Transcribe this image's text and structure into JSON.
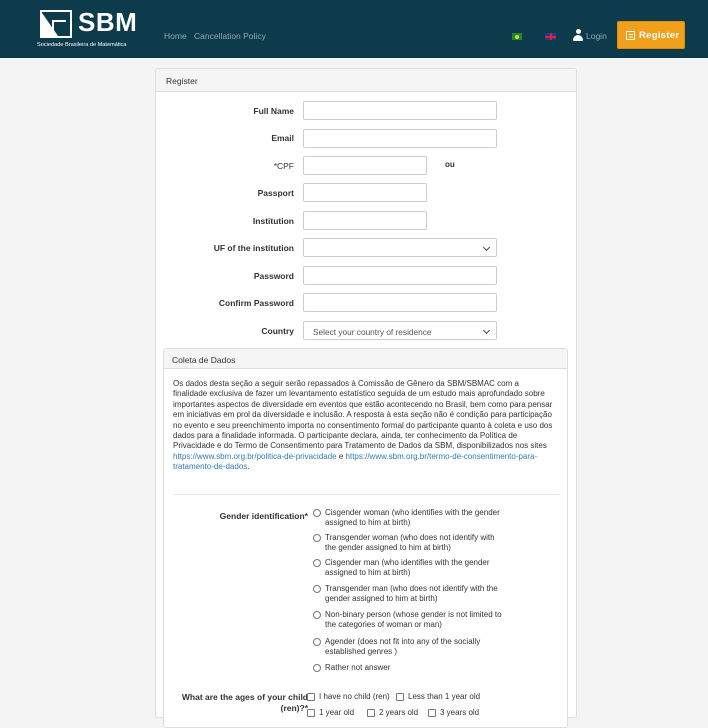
{
  "header": {
    "logo_text": "SBM",
    "logo_subtitle": "Sociedade Brasileira de Matemática",
    "nav": [
      "Home",
      "Cancellation Policy"
    ],
    "login_label": "Login",
    "register_label": "Register",
    "colors": {
      "navbar": "#0d3b4c",
      "accent": "#f0a01a"
    }
  },
  "form": {
    "title": "Register",
    "fields": {
      "full_name": "Full Name",
      "email": "Email",
      "cpf": "*CPF",
      "cpf_or": "ou",
      "passport": "Passport",
      "institution": "Institution",
      "uf": "UF of the institution",
      "password": "Password",
      "confirm_password": "Confirm Password",
      "country": "Country",
      "country_placeholder": "Select your country of residence"
    }
  },
  "data_collection": {
    "title": "Coleta de Dados",
    "paragraph": "Os dados desta seção a seguir serão repassados à Comissão de Gênero da SBM/SBMAC com a finalidade exclusiva de fazer um levantamento estatístico seguida de um estudo mais aprofundado sobre importantes aspectos de diversidade em eventos que estão acontecendo no Brasil, bem como para pensar em iniciativas em prol da diversidade e inclusão. A resposta à esta seção não é condição para participação no evento e seu preenchimento importa no consentimento formal do participante quanto à coleta e uso dos dados para a finalidade informada. O participante declara, ainda, ter conhecimento da Política de Privacidade e do Termo de Consentimento para Tratamento de Dados da SBM, disponibilizados nos sites",
    "link1": "https://www.sbm.org.br/politica-de-privacidade",
    "link_joiner": " e ",
    "link2": "https://www.sbm.org.br/termo-de-consentimento-para-tratamento-de-dados",
    "link_end": ".",
    "gender_label": "Gender identification*",
    "gender_options": [
      "Cisgender woman (who identifies with the gender assigned to him at birth)",
      "Transgender woman (who does not identify with the gender assigned to him at birth)",
      "Cisgender man (who identifies with the gender assigned to him at birth)",
      "Transgender man (who does not identify with the gender assigned to him at birth)",
      "Non-binary person (whose gender is not limited to the categories of woman or man)",
      "Agender (does not fit into any of the socially established genres )",
      "Rather not answer"
    ],
    "ages_label": "What are the ages of your child (ren)?*",
    "ages_options": [
      "I have no child (ren)",
      "Less than 1 year old",
      "1 year old",
      "2 years old",
      "3 years old"
    ]
  }
}
